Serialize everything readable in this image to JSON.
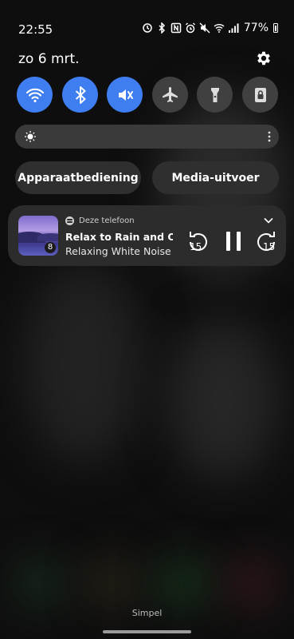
{
  "status": {
    "time": "22:55",
    "battery": "77%",
    "icons": [
      "sync-icon",
      "bluetooth-icon",
      "nfc-icon",
      "alarm-icon",
      "mute-icon",
      "wifi-icon",
      "signal-icon",
      "battery-icon"
    ]
  },
  "date": "zo 6 mrt.",
  "quick_tiles": [
    {
      "name": "wifi",
      "state": "on"
    },
    {
      "name": "bluetooth",
      "state": "on"
    },
    {
      "name": "mute",
      "state": "on"
    },
    {
      "name": "airplane",
      "state": "off"
    },
    {
      "name": "flashlight",
      "state": "off"
    },
    {
      "name": "secure-folder",
      "state": "off"
    }
  ],
  "buttons": {
    "device_control": "Apparaatbediening",
    "media_output": "Media-uitvoer"
  },
  "media": {
    "source": "Deze telefoon",
    "title": "Relax to Rain and Oce…",
    "artist": "Relaxing White Noise",
    "album_badge": "8",
    "rewind_label": "15",
    "forward_label": "15"
  },
  "footer": {
    "mode": "Simpel"
  },
  "colors": {
    "tile_on": "#3e7ef0",
    "tile_off": "#404040",
    "card": "#2c2c2c"
  }
}
